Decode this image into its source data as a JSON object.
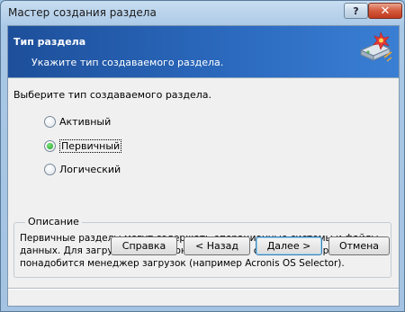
{
  "window": {
    "title": "Мастер создания раздела",
    "help_glyph": "?",
    "close_glyph": "✕"
  },
  "header": {
    "title": "Тип раздела",
    "subtitle": "Укажите тип создаваемого раздела.",
    "icon": "disk-wizard-icon"
  },
  "main": {
    "prompt": "Выберите тип создаваемого раздела.",
    "options": [
      {
        "label": "Активный",
        "checked": false
      },
      {
        "label": "Первичный",
        "checked": true
      },
      {
        "label": "Логический",
        "checked": false
      }
    ],
    "description": {
      "legend": "Описание",
      "text": "Первичные разделы могут содержать операционные системы и файлы данных. Для загрузки операционной системы с первичного раздела вам понадобится менеджер загрузок (например Acronis OS Selector)."
    }
  },
  "buttons": {
    "help": "Справка",
    "back": "< Назад",
    "next": "Далее >",
    "cancel": "Отмена"
  },
  "colors": {
    "header_start": "#1d4f9a",
    "header_end": "#3a7fd4",
    "radio_checked": "#1f9a1f"
  }
}
